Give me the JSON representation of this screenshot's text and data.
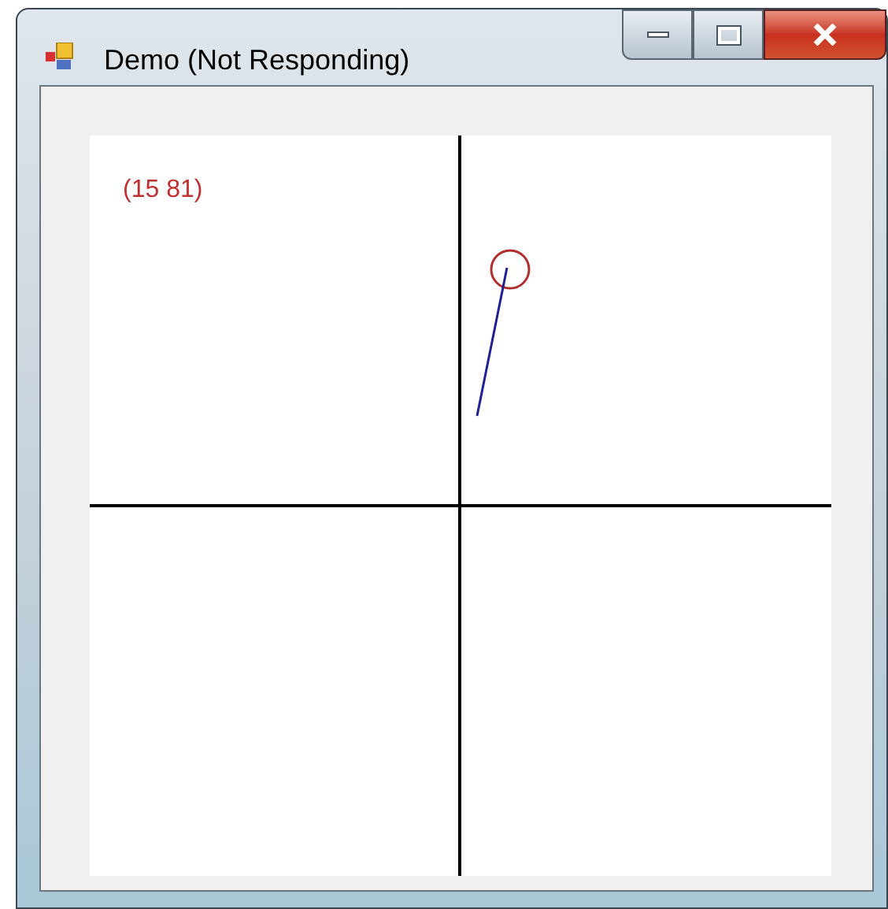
{
  "window": {
    "title": "Demo (Not Responding)"
  },
  "canvas": {
    "coordinate_label": "(15 81)"
  }
}
